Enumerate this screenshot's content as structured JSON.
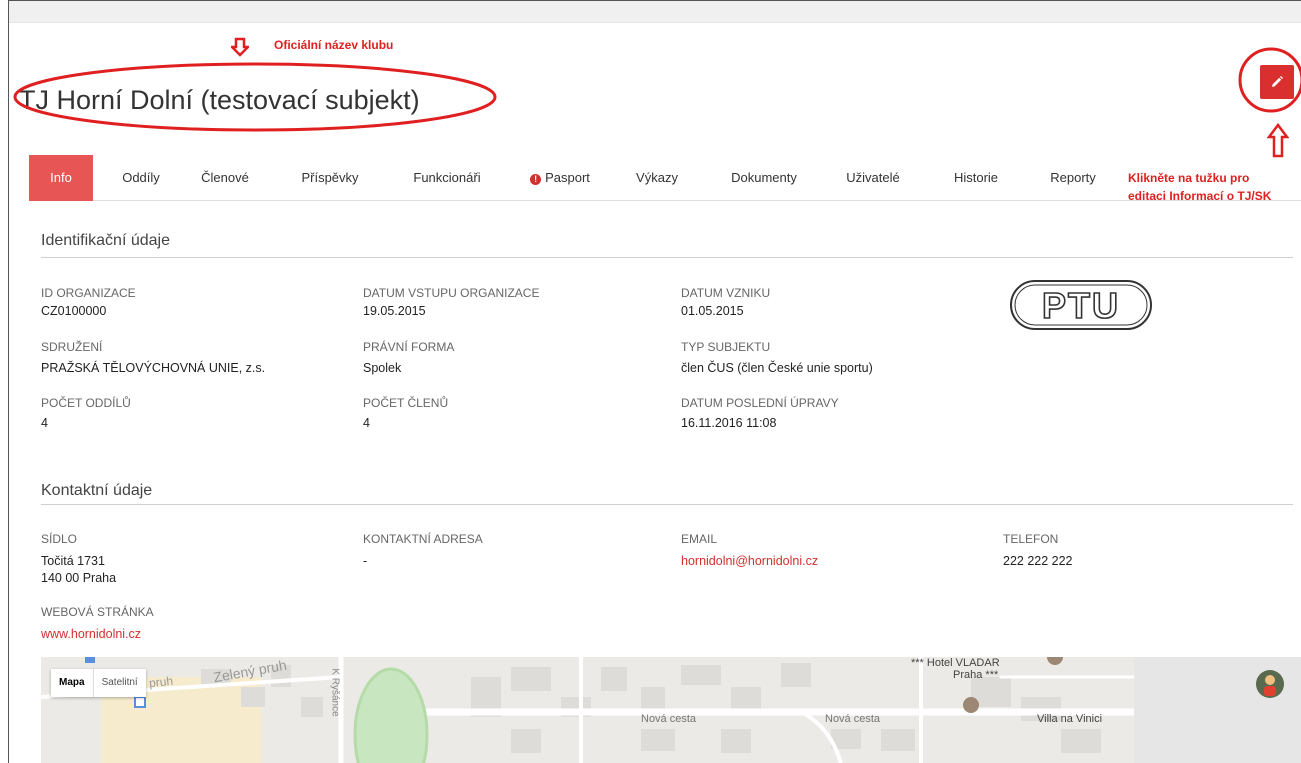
{
  "club": {
    "title": "TJ Horní Dolní (testovací subjekt)"
  },
  "tabs": [
    {
      "label": "Info",
      "active": true
    },
    {
      "label": "Oddíly"
    },
    {
      "label": "Členové"
    },
    {
      "label": "Příspěvky"
    },
    {
      "label": "Funkcionáři"
    },
    {
      "label": "Pasport",
      "icon": "warning-icon"
    },
    {
      "label": "Výkazy"
    },
    {
      "label": "Dokumenty"
    },
    {
      "label": "Uživatelé"
    },
    {
      "label": "Historie"
    },
    {
      "label": "Reporty"
    }
  ],
  "ident": {
    "section_title": "Identifikační údaje",
    "id_label": "ID ORGANIZACE",
    "id_value": "CZ0100000",
    "entry_label": "DATUM VSTUPU ORGANIZACE",
    "entry_value": "19.05.2015",
    "founded_label": "DATUM VZNIKU",
    "founded_value": "01.05.2015",
    "union_label": "SDRUŽENÍ",
    "union_value": "PRAŽSKÁ TĚLOVÝCHOVNÁ UNIE, z.s.",
    "legal_label": "PRÁVNÍ FORMA",
    "legal_value": "Spolek",
    "type_label": "TYP SUBJEKTU",
    "type_value": "člen ČUS (člen České unie sportu)",
    "sections_label": "POČET ODDÍLŮ",
    "sections_value": "4",
    "members_label": "POČET ČLENŮ",
    "members_value": "4",
    "modified_label": "DATUM POSLEDNÍ ÚPRAVY",
    "modified_value": "16.11.2016 11:08",
    "logo_text": "PTU"
  },
  "contact": {
    "section_title": "Kontaktní údaje",
    "seat_label": "SÍDLO",
    "seat_line1": "Točitá 1731",
    "seat_line2": "140 00 Praha",
    "address_label": "KONTAKTNÍ ADRESA",
    "address_value": "-",
    "email_label": "EMAIL",
    "email_value": "hornidolni@hornidolni.cz",
    "phone_label": "TELEFON",
    "phone_value": "222 222 222",
    "web_label": "WEBOVÁ STRÁNKA",
    "web_value": "www.hornidolni.cz"
  },
  "map": {
    "type_map": "Mapa",
    "type_satellite": "Satelitní",
    "labels": [
      "Zelený pruh",
      "pruh",
      "K Ryšánce",
      "Nová cesta",
      "Nová cesta",
      "*** Hotel VLADAR",
      "Praha ***",
      "Villa na Vinici"
    ]
  },
  "annotations": {
    "top": "Oficiální název klubu",
    "right_line1": "Klikněte na tužku pro",
    "right_line2": "editaci Informací o TJ/SK"
  },
  "colors": {
    "accent": "#e85555",
    "edit_button": "#d92f2f",
    "annotation": "#e02020",
    "link": "#d32f2f"
  }
}
